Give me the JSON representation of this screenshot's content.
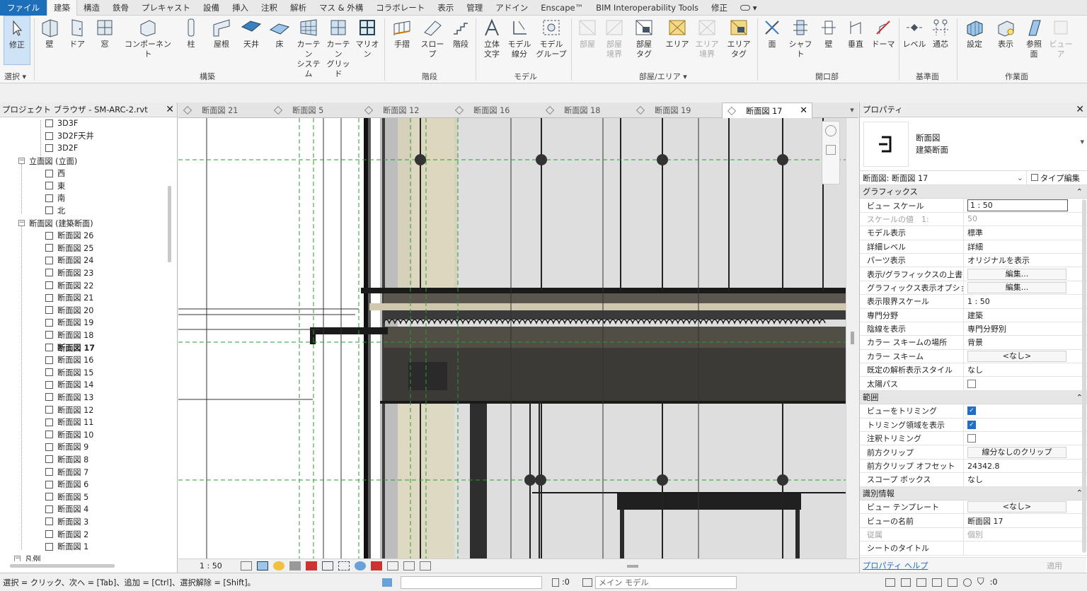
{
  "ribbon_tabs": [
    {
      "label": "ファイル"
    },
    {
      "label": "建築"
    },
    {
      "label": "構造"
    },
    {
      "label": "鉄骨"
    },
    {
      "label": "プレキャスト"
    },
    {
      "label": "設備"
    },
    {
      "label": "挿入"
    },
    {
      "label": "注釈"
    },
    {
      "label": "解析"
    },
    {
      "label": "マス & 外構"
    },
    {
      "label": "コラボレート"
    },
    {
      "label": "表示"
    },
    {
      "label": "管理"
    },
    {
      "label": "アドイン"
    },
    {
      "label": "Enscape™"
    },
    {
      "label": "BIM Interoperability Tools"
    },
    {
      "label": "修正"
    }
  ],
  "ribbon": {
    "buttons": {
      "modify": "修正",
      "wall": "壁",
      "door": "ドア",
      "window": "窓",
      "component": "コンポーネント",
      "column": "柱",
      "roof": "屋根",
      "ceiling": "天井",
      "floor": "床",
      "curtain_system": "カーテン\nシステム",
      "curtain_grid": "カーテン\nグリッド",
      "mullion": "マリオン",
      "railing": "手摺",
      "ramp": "スロープ",
      "stair": "階段",
      "model_text": "立体\n文字",
      "model_line": "モデル\n線分",
      "model_group": "モデル\nグループ",
      "room": "部屋",
      "room_separator": "部屋\n境界",
      "room_tag": "部屋\nタグ",
      "area": "エリア",
      "area_boundary": "エリア\n境界",
      "area_tag": "エリア\nタグ",
      "by_face": "面",
      "shaft": "シャフト",
      "opening_wall": "壁",
      "vertical": "垂直",
      "dormer": "ドーマ",
      "level": "レベル",
      "grid": "通芯",
      "set": "設定",
      "show": "表示",
      "ref_plane": "参照\n面",
      "viewer": "ビューア"
    },
    "panels": {
      "select": "選択 ▾",
      "build": "構築",
      "circulation": "階段",
      "model": "モデル",
      "room_area": "部屋/エリア ▾",
      "opening": "開口部",
      "datum": "基準面",
      "work_plane": "作業面"
    }
  },
  "browser": {
    "title": "プロジェクト ブラウザ - SM-ARC-2.rvt",
    "top_items": [
      {
        "label": "3D3F"
      },
      {
        "label": "3D2F天井"
      },
      {
        "label": "3D2F"
      }
    ],
    "elevation_group": "立面図 (立面)",
    "elevations": [
      {
        "label": "西"
      },
      {
        "label": "東"
      },
      {
        "label": "南"
      },
      {
        "label": "北"
      }
    ],
    "section_group": "断面図 (建築断面)",
    "sections": [
      {
        "label": "断面図 26"
      },
      {
        "label": "断面図 25"
      },
      {
        "label": "断面図 24"
      },
      {
        "label": "断面図 23"
      },
      {
        "label": "断面図 22"
      },
      {
        "label": "断面図 21"
      },
      {
        "label": "断面図 20"
      },
      {
        "label": "断面図 19"
      },
      {
        "label": "断面図 18"
      },
      {
        "label": "断面図 17"
      },
      {
        "label": "断面図 16"
      },
      {
        "label": "断面図 15"
      },
      {
        "label": "断面図 14"
      },
      {
        "label": "断面図 13"
      },
      {
        "label": "断面図 12"
      },
      {
        "label": "断面図 11"
      },
      {
        "label": "断面図 10"
      },
      {
        "label": "断面図 9"
      },
      {
        "label": "断面図 8"
      },
      {
        "label": "断面図 7"
      },
      {
        "label": "断面図 6"
      },
      {
        "label": "断面図 5"
      },
      {
        "label": "断面図 4"
      },
      {
        "label": "断面図 3"
      },
      {
        "label": "断面図 2"
      },
      {
        "label": "断面図 1"
      }
    ],
    "selected": "断面図 17",
    "partial_item": "凡例"
  },
  "view_tabs": [
    {
      "label": "断面図 21"
    },
    {
      "label": "断面図 5"
    },
    {
      "label": "断面図 12"
    },
    {
      "label": "断面図 16"
    },
    {
      "label": "断面図 18"
    },
    {
      "label": "断面図 19"
    },
    {
      "label": "断面図 17"
    }
  ],
  "view_status": {
    "scale": "1 : 50"
  },
  "properties": {
    "title": "プロパティ",
    "type_name": "断面図",
    "type_sub": "建築断面",
    "selector": "断面図: 断面図 17",
    "edit_type": "タイプ編集",
    "groups": [
      {
        "name": "グラフィックス",
        "rows": [
          {
            "key": "ビュー スケール",
            "value": "1 : 50",
            "kind": "input"
          },
          {
            "key": "スケールの値　1:",
            "value": "50",
            "kind": "dim"
          },
          {
            "key": "モデル表示",
            "value": "標準"
          },
          {
            "key": "詳細レベル",
            "value": "詳細"
          },
          {
            "key": "パーツ表示",
            "value": "オリジナルを表示"
          },
          {
            "key": "表示/グラフィックスの上書き",
            "value": "編集...",
            "kind": "button"
          },
          {
            "key": "グラフィックス表示オプション",
            "value": "編集...",
            "kind": "button"
          },
          {
            "key": "表示限界スケール",
            "value": "1 : 50"
          },
          {
            "key": "専門分野",
            "value": "建築"
          },
          {
            "key": "陰線を表示",
            "value": "専門分野別"
          },
          {
            "key": "カラー スキームの場所",
            "value": "背景"
          },
          {
            "key": "カラー スキーム",
            "value": "<なし>",
            "kind": "button"
          },
          {
            "key": "既定の解析表示スタイル",
            "value": "なし"
          },
          {
            "key": "太陽パス",
            "value": "",
            "kind": "check_off"
          }
        ]
      },
      {
        "name": "範囲",
        "rows": [
          {
            "key": "ビューをトリミング",
            "value": "",
            "kind": "check_on"
          },
          {
            "key": "トリミング領域を表示",
            "value": "",
            "kind": "check_on"
          },
          {
            "key": "注釈トリミング",
            "value": "",
            "kind": "check_off"
          },
          {
            "key": "前方クリップ",
            "value": "線分なしのクリップ",
            "kind": "button"
          },
          {
            "key": "前方クリップ オフセット",
            "value": "24342.8"
          },
          {
            "key": "スコープ ボックス",
            "value": "なし"
          }
        ]
      },
      {
        "name": "識別情報",
        "rows": [
          {
            "key": "ビュー テンプレート",
            "value": "<なし>",
            "kind": "button"
          },
          {
            "key": "ビューの名前",
            "value": "断面図 17"
          },
          {
            "key": "従属",
            "value": "個別",
            "kind": "dim"
          },
          {
            "key": "シートのタイトル",
            "value": ""
          }
        ]
      }
    ],
    "help": "プロパティ ヘルプ",
    "apply": "適用"
  },
  "status_bar": {
    "message": "選択 = クリック、次へ = [Tab]、追加 = [Ctrl]、選択解除 = [Shift]。",
    "workset_count": ":0",
    "model": "メイン モデル",
    "filter_count": ":0"
  }
}
